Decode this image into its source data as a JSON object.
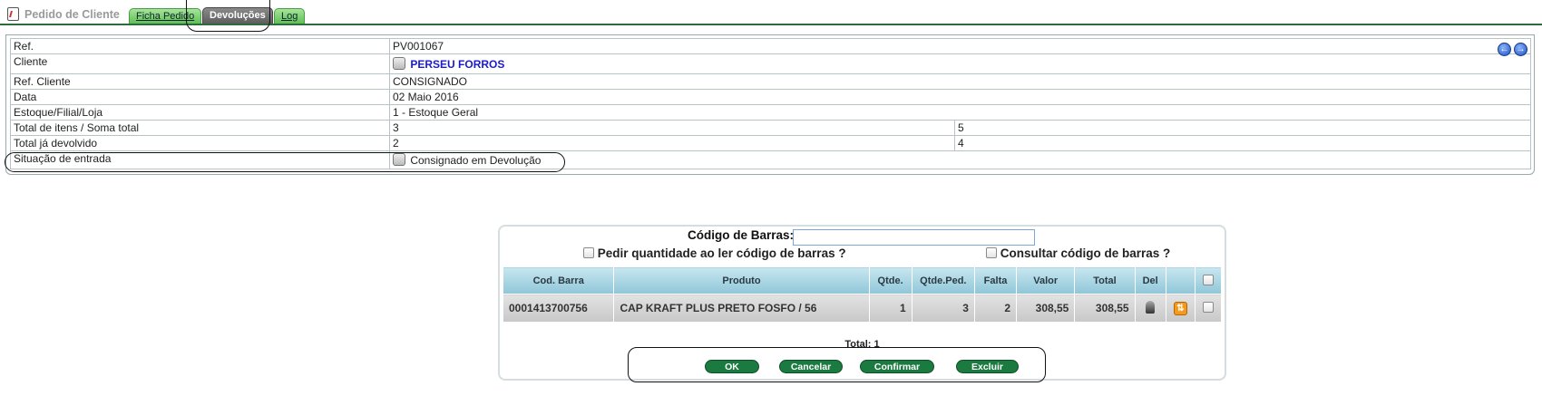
{
  "header": {
    "title": "Pedido de Cliente",
    "tabs": [
      {
        "label": "Ficha Pedido"
      },
      {
        "label": "Devoluções"
      },
      {
        "label": "Log"
      }
    ]
  },
  "info": {
    "rows": [
      {
        "label": "Ref.",
        "value": "PV001067"
      },
      {
        "label": "Cliente",
        "value": "PERSEU FORROS"
      },
      {
        "label": "Ref. Cliente",
        "value": "CONSIGNADO"
      },
      {
        "label": "Data",
        "value": "02 Maio 2016"
      },
      {
        "label": "Estoque/Filial/Loja",
        "value": "1 - Estoque Geral"
      },
      {
        "label": "Total de itens / Soma total",
        "value": "3",
        "value2": "5"
      },
      {
        "label": "Total já devolvido",
        "value": "2",
        "value2": "4"
      },
      {
        "label": "Situação de entrada",
        "value": "Consignado em Devolução"
      }
    ]
  },
  "devolucao": {
    "barcode_label": "Código de Barras:",
    "barcode_value": "",
    "option_qty": "Pedir quantidade ao ler código de barras ?",
    "option_consult": "Consultar código de barras ?",
    "columns": [
      "Cod. Barra",
      "Produto",
      "Qtde.",
      "Qtde.Ped.",
      "Falta",
      "Valor",
      "Total",
      "Del"
    ],
    "items": [
      {
        "barcode": "0001413700756",
        "product": "CAP KRAFT PLUS PRETO FOSFO / 56",
        "qty": "1",
        "qty_ordered": "3",
        "missing": "2",
        "value": "308,55",
        "total": "308,55"
      }
    ],
    "total_label": "Total: 1",
    "buttons": {
      "ok": "OK",
      "cancel": "Cancelar",
      "confirm": "Confirmar",
      "delete": "Excluir"
    }
  },
  "icons": {
    "nav_prev": "arrow-left-circle-icon",
    "nav_next": "arrow-right-circle-icon",
    "client": "client-card-icon",
    "status": "status-icon",
    "delete": "trash-icon",
    "edit": "orange-action-icon"
  },
  "colors": {
    "tab_green": "#5fbf55",
    "tab_active": "#5d5d5d",
    "link_blue": "#1a1acc",
    "table_header": "#8fc6d8",
    "button_green": "#1a7a3f"
  }
}
